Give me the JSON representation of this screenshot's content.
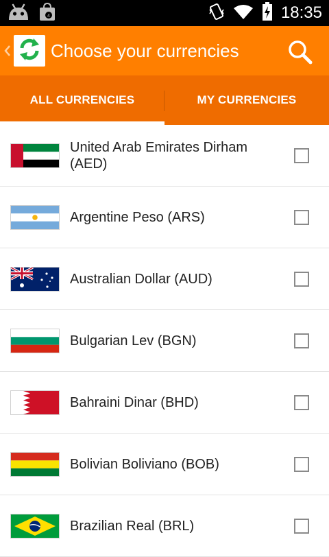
{
  "status_bar": {
    "time": "18:35",
    "left_icons": [
      "android-debug-icon",
      "shopping-bag-icon"
    ],
    "right_icons": [
      "vibrate-icon",
      "wifi-icon",
      "battery-charging-icon"
    ]
  },
  "app_bar": {
    "title": "Choose your currencies",
    "back_icon": "chevron-left-icon",
    "logo_icon": "sync-arrows-icon",
    "action_icon": "search-icon",
    "color": "#ff7f00"
  },
  "tabs": [
    {
      "label": "ALL CURRENCIES",
      "selected": true
    },
    {
      "label": "MY CURRENCIES",
      "selected": false
    }
  ],
  "currencies": [
    {
      "name": "United Arab Emirates Dirham (AED)",
      "flag": "ae-flag-icon",
      "checked": false
    },
    {
      "name": "Argentine Peso (ARS)",
      "flag": "ar-flag-icon",
      "checked": false
    },
    {
      "name": "Australian Dollar (AUD)",
      "flag": "au-flag-icon",
      "checked": false
    },
    {
      "name": "Bulgarian Lev (BGN)",
      "flag": "bg-flag-icon",
      "checked": false
    },
    {
      "name": "Bahraini Dinar (BHD)",
      "flag": "bh-flag-icon",
      "checked": false
    },
    {
      "name": "Bolivian Boliviano (BOB)",
      "flag": "bo-flag-icon",
      "checked": false
    },
    {
      "name": "Brazilian Real (BRL)",
      "flag": "br-flag-icon",
      "checked": false
    }
  ]
}
